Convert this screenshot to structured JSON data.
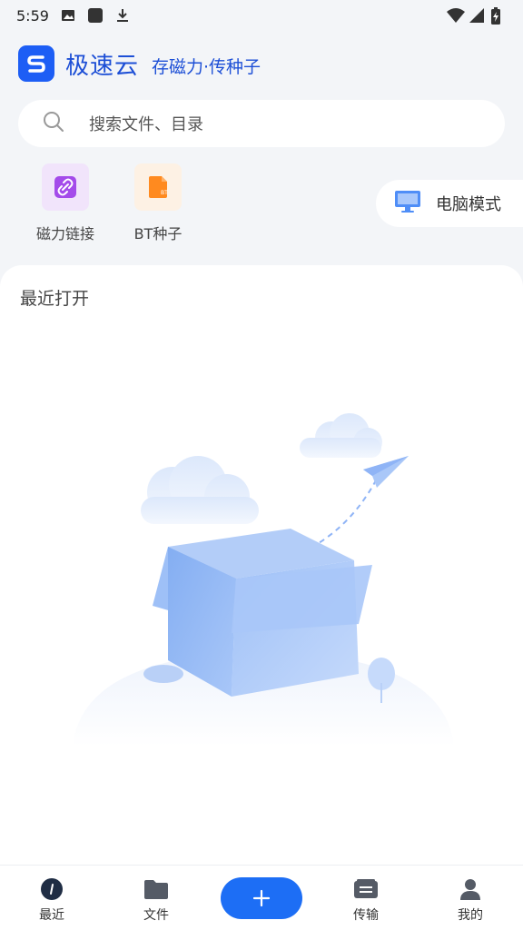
{
  "status_bar": {
    "time": "5:59",
    "icons_left": [
      "image-icon",
      "square-icon",
      "download-icon"
    ],
    "icons_right": [
      "wifi-icon",
      "signal-icon",
      "battery-charging-icon"
    ]
  },
  "header": {
    "app_name": "极速云",
    "slogan": "存磁力·传种子"
  },
  "search": {
    "placeholder": "搜索文件、目录"
  },
  "quick_actions": [
    {
      "label": "磁力链接",
      "icon": "link-icon",
      "color": "#a44bea"
    },
    {
      "label": "BT种子",
      "icon": "bt-file-icon",
      "color": "#ff8a1f"
    }
  ],
  "pc_mode": {
    "label": "电脑模式"
  },
  "recent": {
    "title": "最近打开"
  },
  "bottom_nav": {
    "items": [
      {
        "label": "最近",
        "active": true
      },
      {
        "label": "文件",
        "active": false
      },
      {
        "label": "传输",
        "active": false
      },
      {
        "label": "我的",
        "active": false
      }
    ]
  },
  "colors": {
    "brand": "#1d5ef5",
    "background": "#f3f5f8",
    "add_button": "#1d6ef5"
  }
}
